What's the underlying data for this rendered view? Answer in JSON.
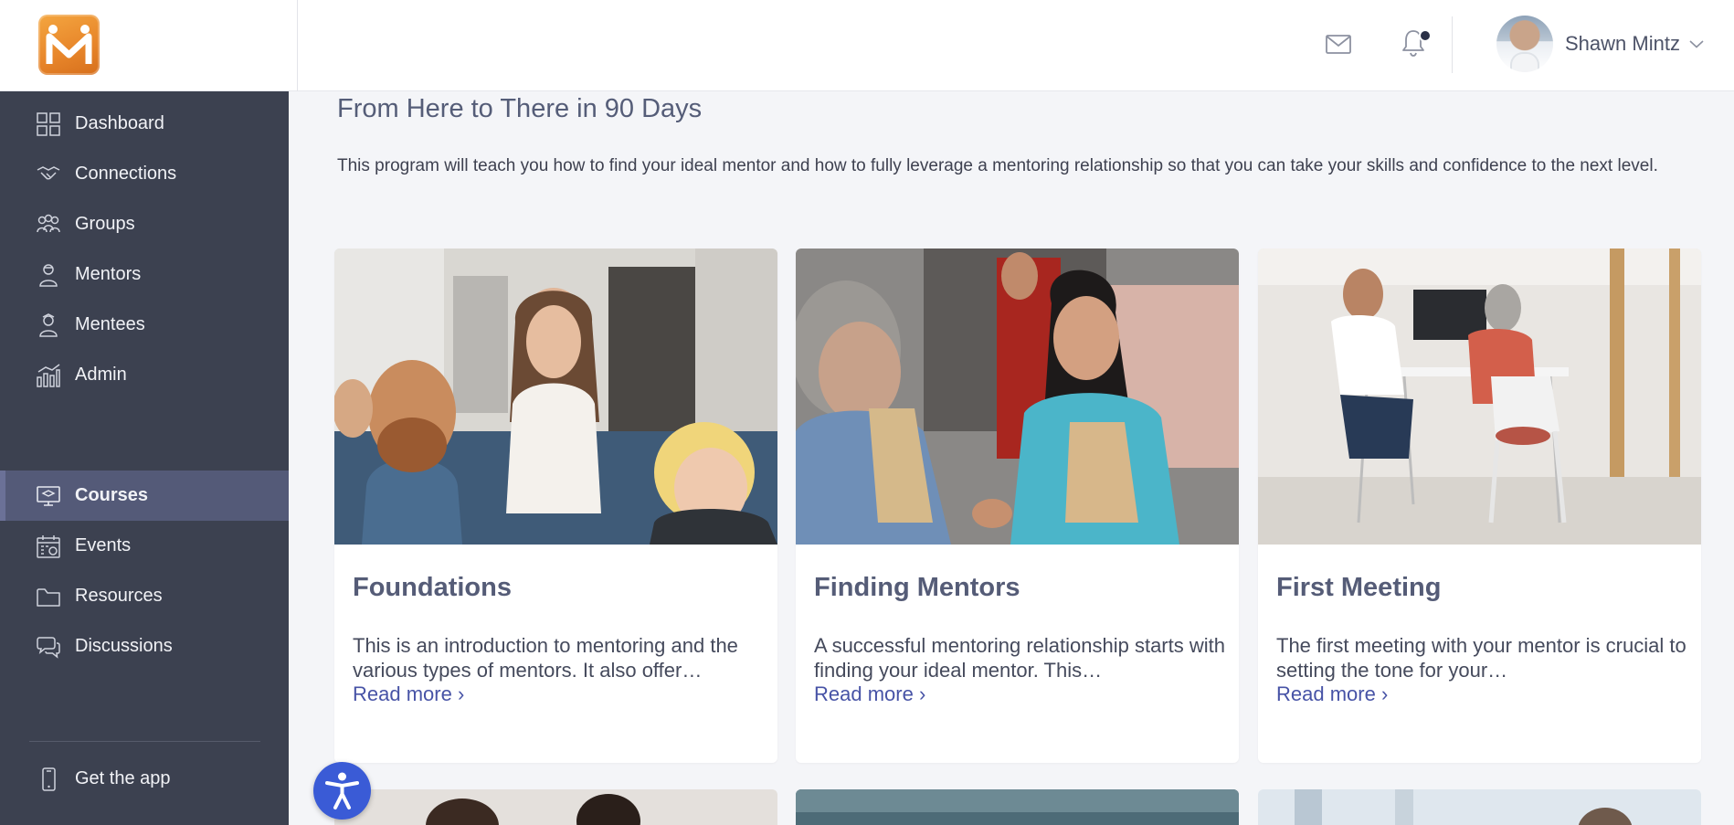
{
  "header": {
    "user_name": "Shawn Mintz"
  },
  "sidebar": {
    "items": [
      {
        "label": "Dashboard",
        "icon": "dashboard-icon"
      },
      {
        "label": "Connections",
        "icon": "handshake-icon"
      },
      {
        "label": "Groups",
        "icon": "groups-icon"
      },
      {
        "label": "Mentors",
        "icon": "mentor-icon"
      },
      {
        "label": "Mentees",
        "icon": "mentee-icon"
      },
      {
        "label": "Admin",
        "icon": "admin-chart-icon"
      },
      {
        "label": "Courses",
        "icon": "courses-icon",
        "active": true
      },
      {
        "label": "Events",
        "icon": "calendar-icon"
      },
      {
        "label": "Resources",
        "icon": "folder-icon"
      },
      {
        "label": "Discussions",
        "icon": "chat-icon"
      }
    ],
    "footer": {
      "label": "Get the app",
      "icon": "phone-icon"
    }
  },
  "program": {
    "title": "From Here to There in 90 Days",
    "description": "This program will teach you how to find your ideal mentor and how to fully leverage a mentoring relationship so that you can take your skills and confidence to the next level."
  },
  "courses": [
    {
      "title": "Foundations",
      "text": "This is an introduction to mentoring and the various types of mentors. It also offer…",
      "link": "Read more ›"
    },
    {
      "title": "Finding Mentors",
      "text": "A successful mentoring relationship starts with finding your ideal mentor. This…",
      "link": "Read more ›"
    },
    {
      "title": "First Meeting",
      "text": "The first meeting with your mentor is crucial to setting the tone for your…",
      "link": "Read more ›"
    }
  ],
  "colors": {
    "sidebar_bg": "#3c4150",
    "sidebar_active": "#545a78",
    "link": "#4753a6",
    "accessibility_button": "#3a5bd6",
    "logo_orange": "#e7852a"
  }
}
